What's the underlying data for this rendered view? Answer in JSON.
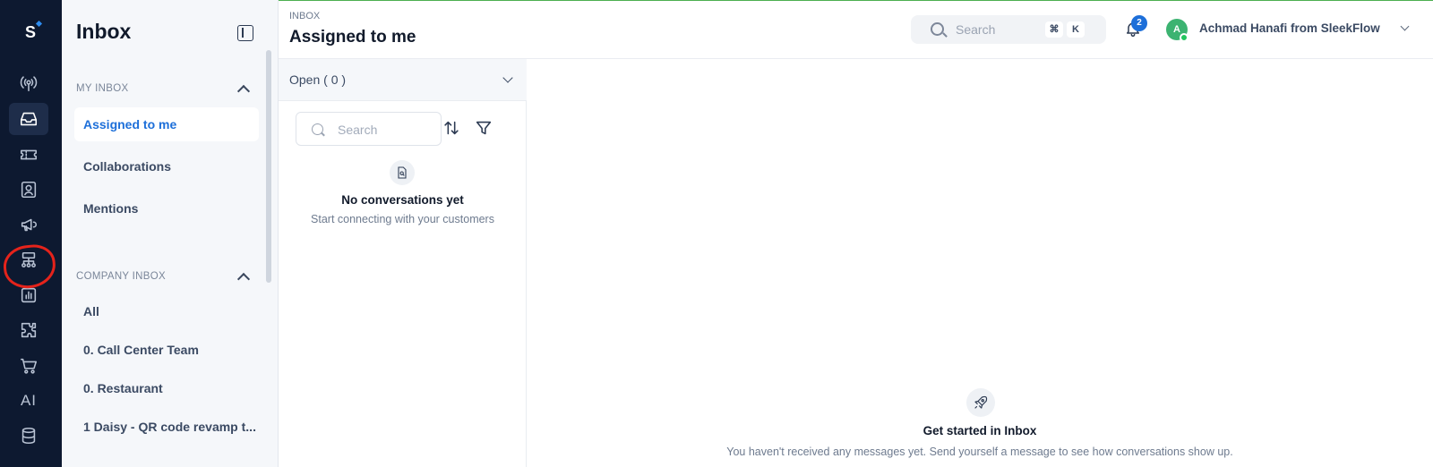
{
  "rail": {
    "logo": "S",
    "items": [
      {
        "icon": "broadcast-icon"
      },
      {
        "icon": "inbox-icon",
        "active": true
      },
      {
        "icon": "ticket-icon"
      },
      {
        "icon": "contact-icon"
      },
      {
        "icon": "megaphone-icon"
      },
      {
        "icon": "flow-builder-icon"
      },
      {
        "icon": "analytics-icon"
      },
      {
        "icon": "integrations-icon"
      },
      {
        "icon": "commerce-icon"
      },
      {
        "icon": "ai-icon",
        "label": "AI"
      },
      {
        "icon": "database-icon"
      }
    ],
    "annotation_color": "#e5231b"
  },
  "sidebar": {
    "title": "Inbox",
    "my_inbox": {
      "heading": "MY INBOX",
      "items": [
        "Assigned to me",
        "Collaborations",
        "Mentions"
      ]
    },
    "company_inbox": {
      "heading": "COMPANY INBOX",
      "items": [
        "All",
        "0. Call Center Team",
        "0. Restaurant",
        "1 Daisy - QR code revamp t..."
      ]
    }
  },
  "header": {
    "breadcrumb": "INBOX",
    "title": "Assigned to me",
    "search_placeholder": "Search",
    "shortcut_keys": [
      "⌘",
      "K"
    ],
    "notification_count": "2",
    "user_initial": "A",
    "user_name": "Achmad Hanafi from SleekFlow"
  },
  "conversations": {
    "status_label": "Open ( 0 )",
    "search_placeholder": "Search",
    "empty_title": "No conversations yet",
    "empty_subtitle": "Start connecting with your customers"
  },
  "main": {
    "title": "Get started in Inbox",
    "subtitle": "You haven't received any messages yet. Send yourself a message to see how conversations show up."
  },
  "colors": {
    "rail_bg": "#0d1930",
    "accent": "#1d6fd9",
    "online": "#22c55e"
  }
}
